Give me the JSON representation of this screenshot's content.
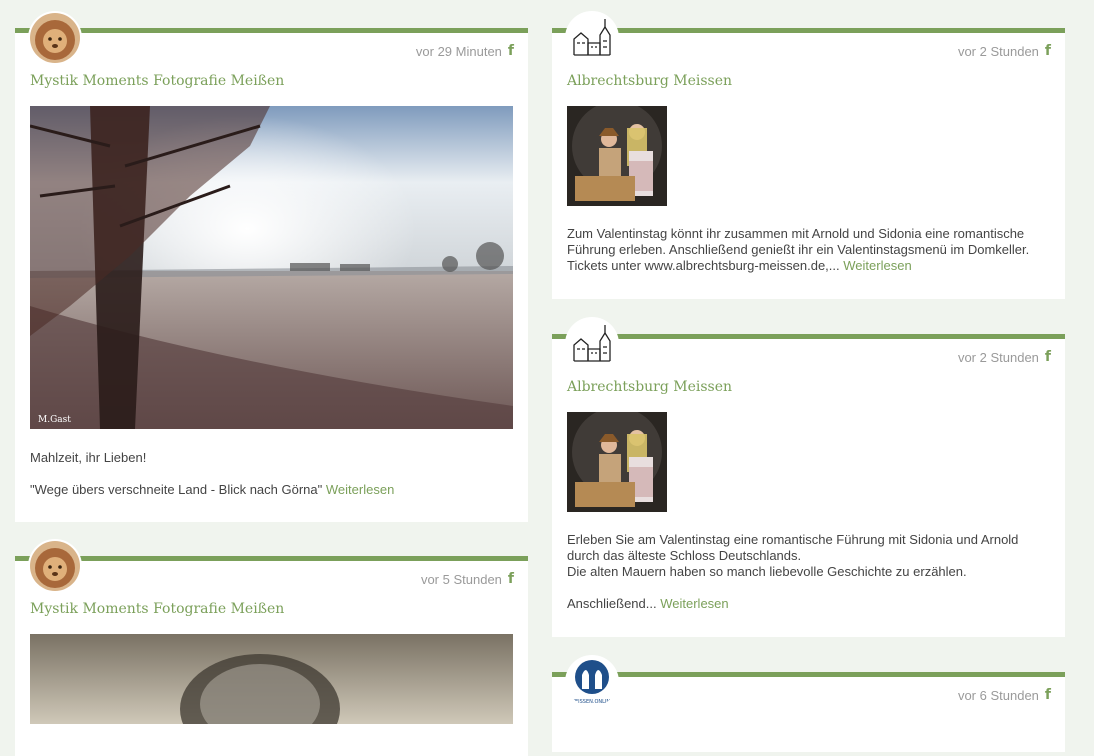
{
  "posts": [
    {
      "author": "Mystik Moments Fotografie Meißen",
      "time": "vor 29 Minuten",
      "source_icon": "facebook-icon",
      "avatar_icon": "lion-avatar",
      "image_signature": "M.Gast",
      "paragraphs": [
        "Mahlzeit, ihr Lieben!"
      ],
      "last_text": "\"Wege übers verschneite Land - Blick nach Görna\"",
      "more": "Weiterlesen"
    },
    {
      "author": "Albrechtsburg Meissen",
      "time": "vor 2 Stunden",
      "source_icon": "facebook-icon",
      "avatar_icon": "castle-avatar",
      "last_text": "Zum Valentinstag könnt ihr zusammen mit Arnold und Sidonia eine romantische Führung erleben. Anschließend genießt ihr ein Valentinstagsmenü im Domkeller. Tickets unter www.albrechtsburg-meissen.de,...",
      "more": "Weiterlesen"
    },
    {
      "author": "Albrechtsburg Meissen",
      "time": "vor 2 Stunden",
      "source_icon": "facebook-icon",
      "avatar_icon": "castle-avatar",
      "paragraphs": [
        "Erleben Sie am Valentinstag eine romantische Führung mit Sidonia und Arnold durch das älteste Schloss Deutschlands.",
        "Die alten Mauern haben so manch liebevolle Geschichte zu erzählen."
      ],
      "last_text": "Anschließend...",
      "more": "Weiterlesen"
    },
    {
      "author": "Mystik Moments Fotografie Meißen",
      "time": "vor 5 Stunden",
      "source_icon": "facebook-icon",
      "avatar_icon": "lion-avatar"
    },
    {
      "time": "vor 6 Stunden",
      "source_icon": "facebook-icon",
      "avatar_icon": "meissen-online-logo",
      "logo_text": "MEISSEN.ONLINE"
    }
  ],
  "colors": {
    "accent": "#7ba05a",
    "background": "#f0f4ee",
    "card": "#ffffff",
    "meta": "#9a9a9a"
  }
}
